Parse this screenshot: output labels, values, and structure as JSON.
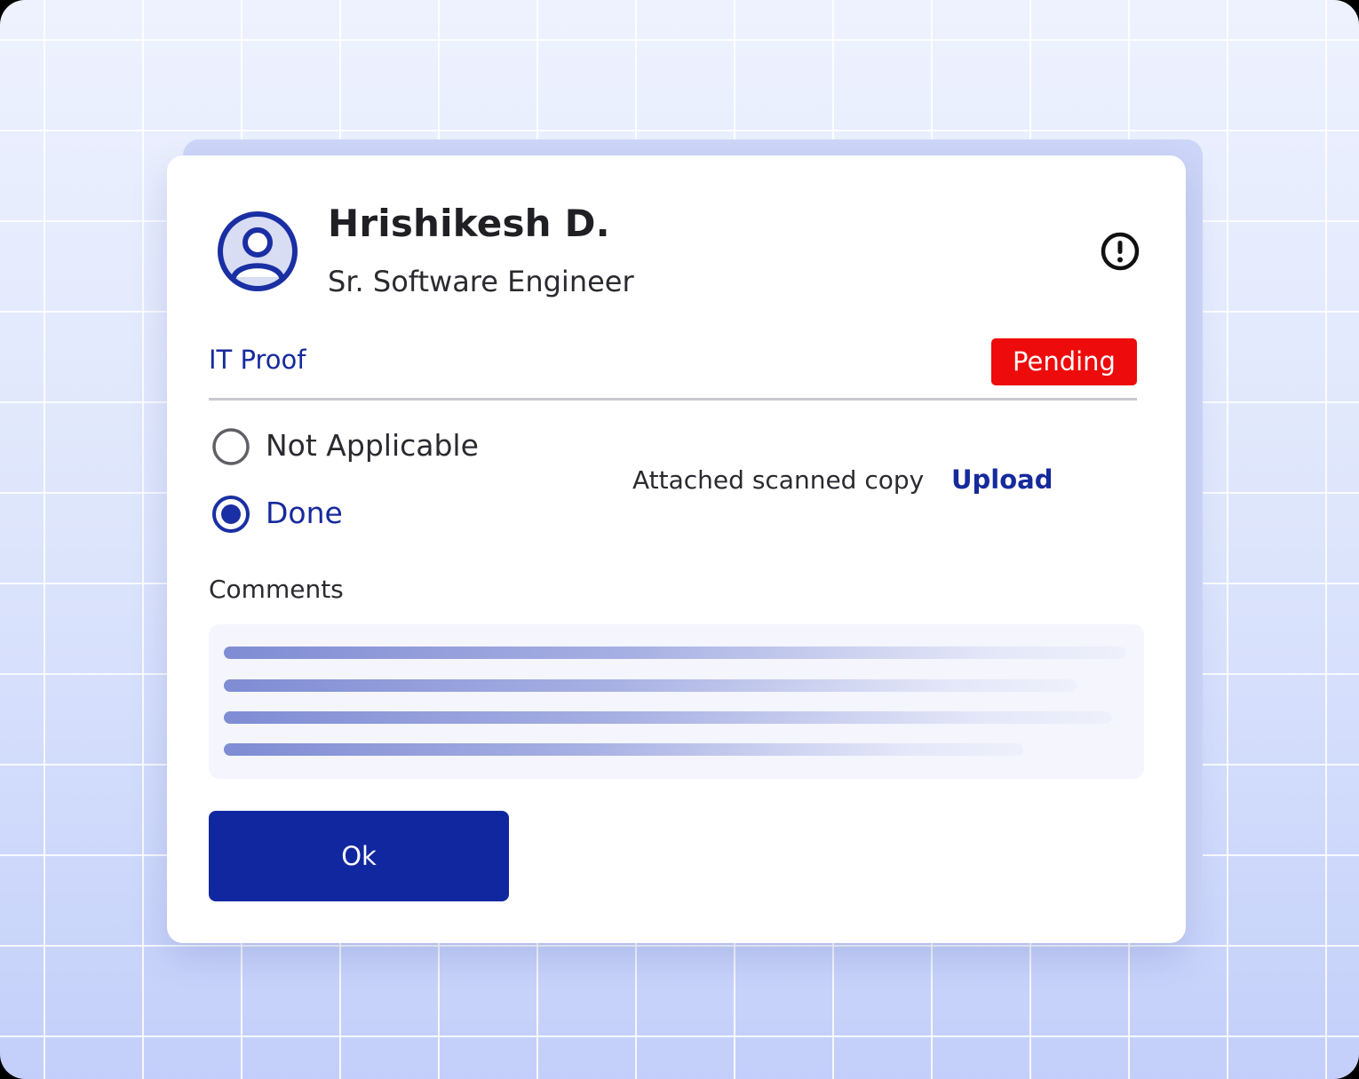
{
  "profile": {
    "name": "Hrishikesh D.",
    "role": "Sr. Software Engineer",
    "avatar_icon": "user-circle-icon",
    "alert_icon": "exclamation-circle-icon"
  },
  "section": {
    "title": "IT Proof",
    "status": "Pending",
    "status_color": "#ee0b0b"
  },
  "options": {
    "not_applicable": "Not Applicable",
    "done": "Done",
    "selected": "done"
  },
  "attachment": {
    "label": "Attached scanned copy",
    "action": "Upload"
  },
  "comments": {
    "label": "Comments"
  },
  "actions": {
    "ok_label": "Ok"
  },
  "colors": {
    "primary": "#1127a0",
    "accent_text": "#162a9c",
    "danger": "#ee0b0b"
  }
}
